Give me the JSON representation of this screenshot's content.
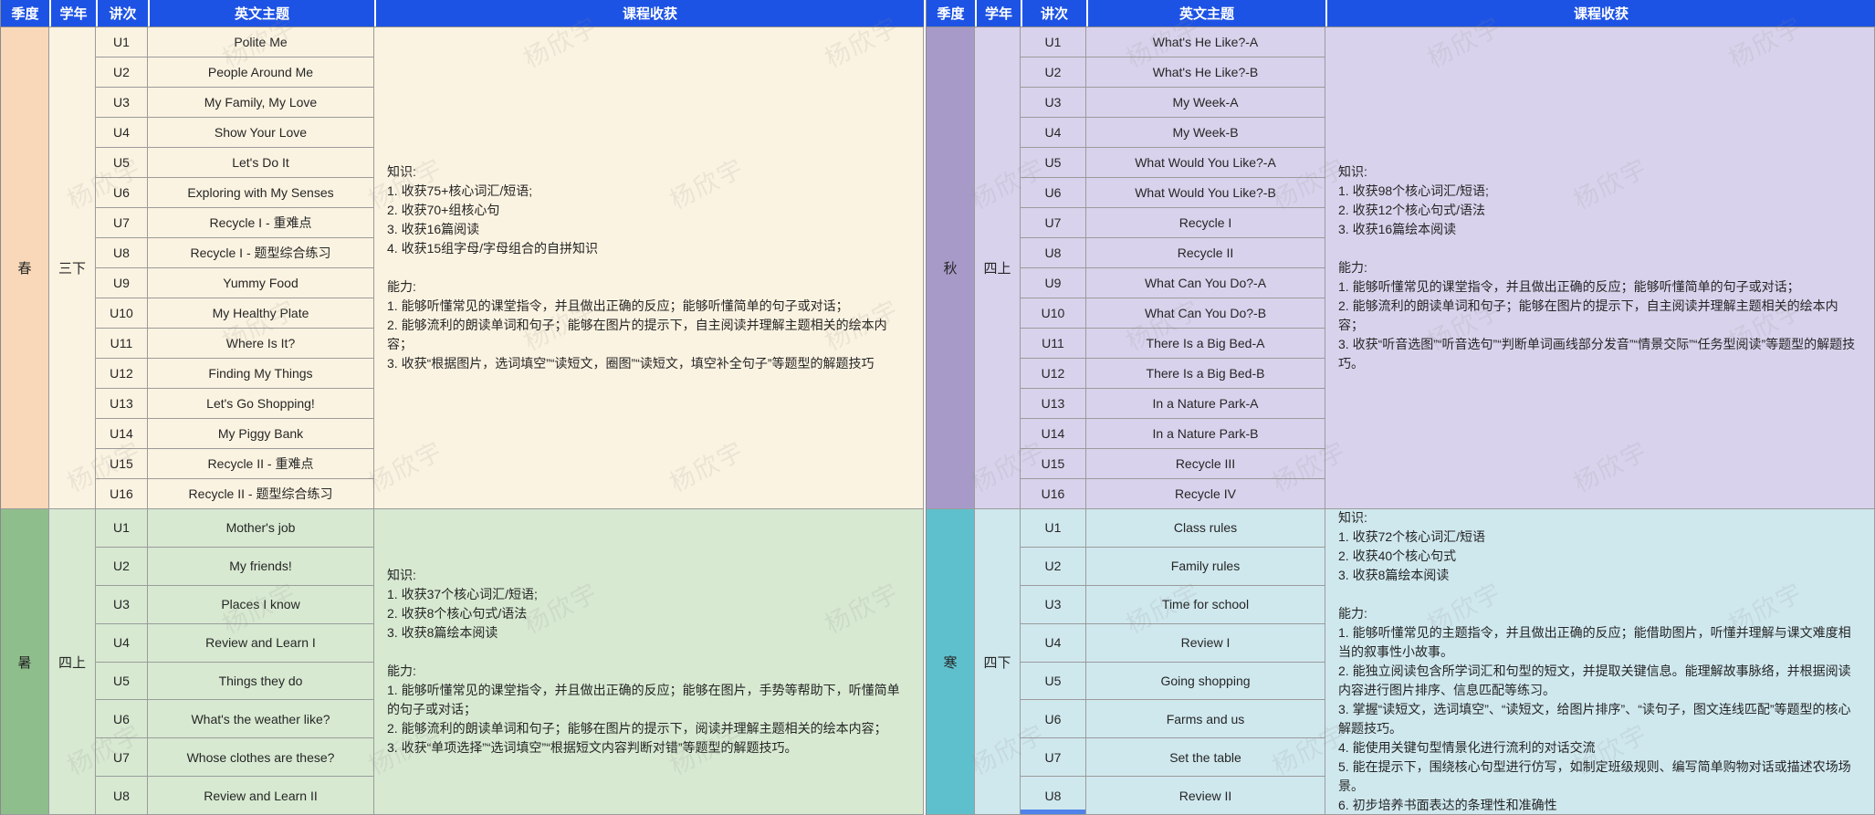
{
  "watermark": {
    "text": "杨欣宇"
  },
  "colors": {
    "header_bg": "#1d53e4",
    "header_text": "#ffffff",
    "border": "#9b9b9b",
    "selection": "#4f82ea",
    "spring_season_bg": "#f8d8b8",
    "spring_body_bg": "#fbf3e1",
    "summer_season_bg": "#8fbe8d",
    "summer_body_bg": "#d7e9d1",
    "autumn_season_bg": "#a79ac9",
    "autumn_body_bg": "#d9d2ec",
    "winter_season_bg": "#5fc0cd",
    "winter_body_bg": "#cfe8ee"
  },
  "columns": [
    "季度",
    "学年",
    "讲次",
    "英文主题",
    "课程收获"
  ],
  "tables": [
    {
      "name": "left",
      "sections": [
        {
          "season": "春",
          "grade": "三下",
          "season_bg": "#f8d8b8",
          "body_bg": "#fbf3e1",
          "units": [
            {
              "u": "U1",
              "topic": "Polite Me"
            },
            {
              "u": "U2",
              "topic": "People Around Me"
            },
            {
              "u": "U3",
              "topic": "My Family, My Love"
            },
            {
              "u": "U4",
              "topic": "Show Your Love"
            },
            {
              "u": "U5",
              "topic": "Let's Do It"
            },
            {
              "u": "U6",
              "topic": "Exploring with My Senses"
            },
            {
              "u": "U7",
              "topic": "Recycle I - 重难点"
            },
            {
              "u": "U8",
              "topic": "Recycle I - 题型综合练习"
            },
            {
              "u": "U9",
              "topic": "Yummy Food"
            },
            {
              "u": "U10",
              "topic": "My Healthy Plate"
            },
            {
              "u": "U11",
              "topic": "Where Is It?"
            },
            {
              "u": "U12",
              "topic": "Finding My Things"
            },
            {
              "u": "U13",
              "topic": "Let's Go Shopping!"
            },
            {
              "u": "U14",
              "topic": "My Piggy Bank"
            },
            {
              "u": "U15",
              "topic": "Recycle II - 重难点"
            },
            {
              "u": "U16",
              "topic": "Recycle II - 题型综合练习"
            }
          ],
          "gains": "知识:\n1. 收获75+核心词汇/短语;\n2. 收获70+组核心句\n3. 收获16篇阅读\n4. 收获15组字母/字母组合的自拼知识\n\n能力:\n1. 能够听懂常见的课堂指令，并且做出正确的反应；能够听懂简单的句子或对话；\n2. 能够流利的朗读单词和句子；能够在图片的提示下，自主阅读并理解主题相关的绘本内容；\n3. 收获“根据图片，选词填空”“读短文，圈图”“读短文，填空补全句子”等题型的解题技巧"
        },
        {
          "season": "暑",
          "grade": "四上",
          "season_bg": "#8fbe8d",
          "body_bg": "#d7e9d1",
          "units": [
            {
              "u": "U1",
              "topic": "Mother's job"
            },
            {
              "u": "U2",
              "topic": "My friends!"
            },
            {
              "u": "U3",
              "topic": "Places I know"
            },
            {
              "u": "U4",
              "topic": "Review and Learn I"
            },
            {
              "u": "U5",
              "topic": "Things they do"
            },
            {
              "u": "U6",
              "topic": "What's the weather like?"
            },
            {
              "u": "U7",
              "topic": "Whose clothes are these?"
            },
            {
              "u": "U8",
              "topic": "Review and Learn II"
            }
          ],
          "gains": "知识:\n1. 收获37个核心词汇/短语;\n2. 收获8个核心句式/语法\n3. 收获8篇绘本阅读\n\n能力:\n1. 能够听懂常见的课堂指令，并且做出正确的反应；能够在图片，手势等帮助下，听懂简单的句子或对话；\n2. 能够流利的朗读单词和句子；能够在图片的提示下，阅读并理解主题相关的绘本内容；\n3. 收获“单项选择”“选词填空”“根据短文内容判断对错”等题型的解题技巧。"
        }
      ]
    },
    {
      "name": "right",
      "sections": [
        {
          "season": "秋",
          "grade": "四上",
          "season_bg": "#a79ac9",
          "body_bg": "#d9d2ec",
          "units": [
            {
              "u": "U1",
              "topic": "What's He Like?-A"
            },
            {
              "u": "U2",
              "topic": "What's He Like?-B"
            },
            {
              "u": "U3",
              "topic": "My Week-A"
            },
            {
              "u": "U4",
              "topic": "My Week-B"
            },
            {
              "u": "U5",
              "topic": "What Would You Like?-A"
            },
            {
              "u": "U6",
              "topic": "What Would You Like?-B"
            },
            {
              "u": "U7",
              "topic": "Recycle I"
            },
            {
              "u": "U8",
              "topic": "Recycle II"
            },
            {
              "u": "U9",
              "topic": "What Can You Do?-A"
            },
            {
              "u": "U10",
              "topic": "What Can You Do?-B"
            },
            {
              "u": "U11",
              "topic": "There Is a Big Bed-A"
            },
            {
              "u": "U12",
              "topic": "There Is a Big Bed-B"
            },
            {
              "u": "U13",
              "topic": "In a Nature Park-A"
            },
            {
              "u": "U14",
              "topic": "In a Nature Park-B"
            },
            {
              "u": "U15",
              "topic": "Recycle III"
            },
            {
              "u": "U16",
              "topic": "Recycle IV"
            }
          ],
          "gains": "知识:\n1. 收获98个核心词汇/短语;\n2. 收获12个核心句式/语法\n3. 收获16篇绘本阅读\n\n能力:\n1. 能够听懂常见的课堂指令，并且做出正确的反应；能够听懂简单的句子或对话；\n2. 能够流利的朗读单词和句子；能够在图片的提示下，自主阅读并理解主题相关的绘本内容；\n3. 收获“听音选图”“听音选句”“判断单词画线部分发音”“情景交际”“任务型阅读”等题型的解题技巧。"
        },
        {
          "season": "寒",
          "grade": "四下",
          "season_bg": "#5fc0cd",
          "body_bg": "#cfe8ee",
          "units": [
            {
              "u": "U1",
              "topic": "Class rules"
            },
            {
              "u": "U2",
              "topic": "Family rules"
            },
            {
              "u": "U3",
              "topic": "Time for school"
            },
            {
              "u": "U4",
              "topic": "Review I"
            },
            {
              "u": "U5",
              "topic": "Going shopping"
            },
            {
              "u": "U6",
              "topic": "Farms and us"
            },
            {
              "u": "U7",
              "topic": "Set the table"
            },
            {
              "u": "U8",
              "topic": "Review II",
              "selected": true
            }
          ],
          "gains": "知识:\n1. 收获72个核心词汇/短语\n2. 收获40个核心句式\n3. 收获8篇绘本阅读\n\n能力:\n1. 能够听懂常见的主题指令，并且做出正确的反应；能借助图片，听懂并理解与课文难度相当的叙事性小故事。\n2. 能独立阅读包含所学词汇和句型的短文，并提取关键信息。能理解故事脉络，并根据阅读内容进行图片排序、信息匹配等练习。\n3. 掌握“读短文，选词填空”、“读短文，给图片排序”、“读句子，图文连线匹配”等题型的核心解题技巧。\n4. 能使用关键句型情景化进行流利的对话交流\n5. 能在提示下，围绕核心句型进行仿写，如制定班级规则、编写简单购物对话或描述农场场景。\n6. 初步培养书面表达的条理性和准确性"
        }
      ]
    }
  ]
}
